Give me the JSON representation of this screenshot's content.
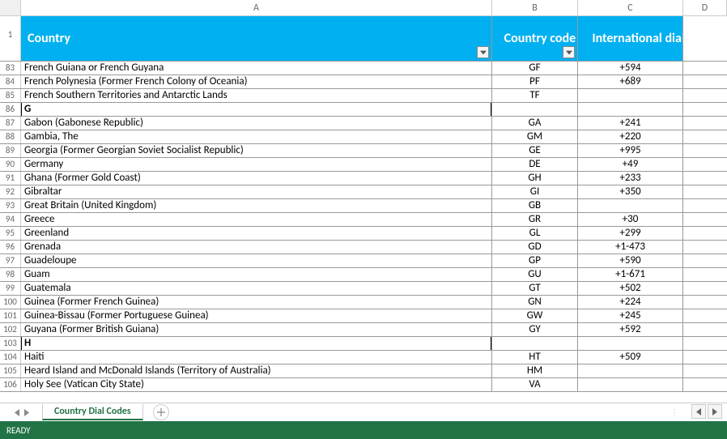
{
  "columns": [
    "A",
    "B",
    "C",
    "D"
  ],
  "header_row_num": "1",
  "headers": {
    "country": "Country",
    "code": "Country code",
    "dialing": "International dialing"
  },
  "chart_data": {
    "type": "table",
    "title": "Country Dial Codes",
    "columns": [
      "Country",
      "Country code",
      "International dialing"
    ],
    "rows": [
      {
        "row": 83,
        "country": "French Guiana or French Guyana",
        "code": "GF",
        "dial": "+594"
      },
      {
        "row": 84,
        "country": "French Polynesia (Former French Colony of Oceania)",
        "code": "PF",
        "dial": "+689"
      },
      {
        "row": 85,
        "country": "French Southern Territories and Antarctic Lands",
        "code": "TF",
        "dial": ""
      },
      {
        "row": 86,
        "country": "G",
        "code": "",
        "dial": "",
        "section": true
      },
      {
        "row": 87,
        "country": "Gabon (Gabonese Republic)",
        "code": "GA",
        "dial": "+241"
      },
      {
        "row": 88,
        "country": "Gambia, The",
        "code": "GM",
        "dial": "+220"
      },
      {
        "row": 89,
        "country": "Georgia (Former Georgian Soviet Socialist Republic)",
        "code": "GE",
        "dial": "+995"
      },
      {
        "row": 90,
        "country": "Germany",
        "code": "DE",
        "dial": "+49"
      },
      {
        "row": 91,
        "country": "Ghana (Former Gold Coast)",
        "code": "GH",
        "dial": "+233"
      },
      {
        "row": 92,
        "country": "Gibraltar",
        "code": "GI",
        "dial": "+350"
      },
      {
        "row": 93,
        "country": "Great Britain (United Kingdom)",
        "code": "GB",
        "dial": ""
      },
      {
        "row": 94,
        "country": "Greece",
        "code": "GR",
        "dial": "+30"
      },
      {
        "row": 95,
        "country": "Greenland",
        "code": "GL",
        "dial": "+299"
      },
      {
        "row": 96,
        "country": "Grenada",
        "code": "GD",
        "dial": "+1-473"
      },
      {
        "row": 97,
        "country": "Guadeloupe",
        "code": "GP",
        "dial": "+590"
      },
      {
        "row": 98,
        "country": "Guam",
        "code": "GU",
        "dial": "+1-671"
      },
      {
        "row": 99,
        "country": "Guatemala",
        "code": "GT",
        "dial": "+502"
      },
      {
        "row": 100,
        "country": "Guinea (Former French Guinea)",
        "code": "GN",
        "dial": "+224"
      },
      {
        "row": 101,
        "country": "Guinea-Bissau (Former Portuguese Guinea)",
        "code": "GW",
        "dial": "+245"
      },
      {
        "row": 102,
        "country": "Guyana (Former British Guiana)",
        "code": "GY",
        "dial": "+592"
      },
      {
        "row": 103,
        "country": "H",
        "code": "",
        "dial": "",
        "section": true
      },
      {
        "row": 104,
        "country": "Haiti",
        "code": "HT",
        "dial": "+509"
      },
      {
        "row": 105,
        "country": "Heard Island and McDonald Islands (Territory of Australia)",
        "code": "HM",
        "dial": ""
      },
      {
        "row": 106,
        "country": "Holy See (Vatican City State)",
        "code": "VA",
        "dial": ""
      }
    ]
  },
  "sheet_tab": "Country Dial Codes",
  "status": "READY"
}
